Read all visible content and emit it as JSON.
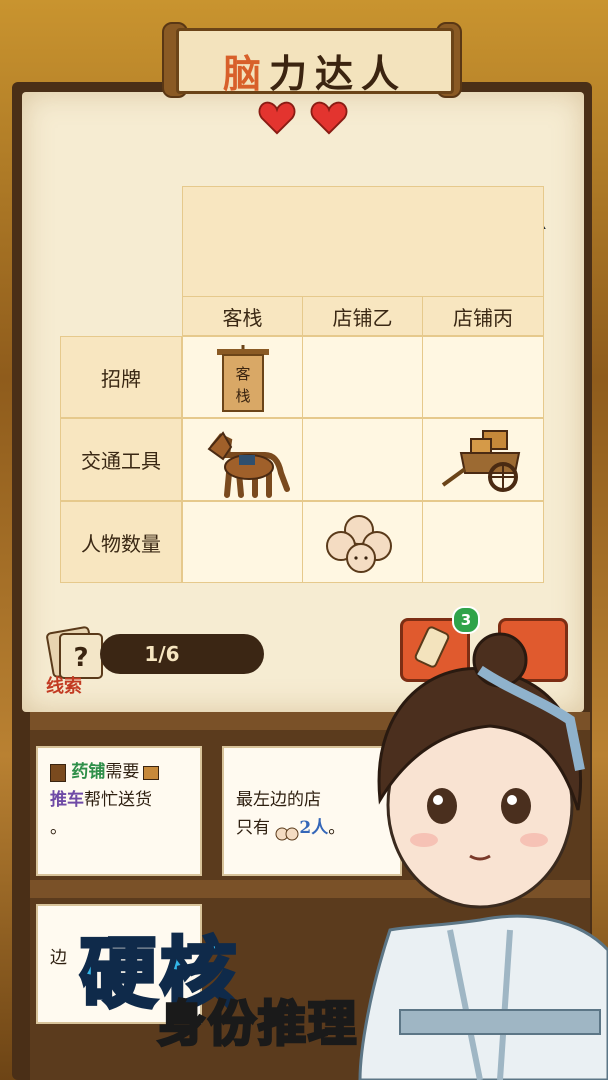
{
  "game": {
    "title_first": "脑",
    "title_rest": "力达人",
    "lives": 2,
    "colors": {
      "accent": "#d8602a",
      "heart": "#e3342f",
      "paper": "#f6ecd2",
      "badge": "#2fa34a"
    }
  },
  "puzzle": {
    "columns": [
      "客栈",
      "店铺乙",
      "店铺丙"
    ],
    "rows": [
      "招牌",
      "交通工具",
      "人物数量"
    ],
    "cells": [
      [
        "signboard-icon",
        "",
        ""
      ],
      [
        "horse-icon",
        "",
        "cart-icon"
      ],
      [
        "",
        "crowd-icon",
        ""
      ]
    ],
    "signboard_text": "客\n栈"
  },
  "clues": {
    "label": "线索",
    "progress": "1/6",
    "badge_count": "3",
    "cards": [
      {
        "part1": "药铺",
        "part2": "需要",
        "part3": "推车",
        "part4": "帮忙送货",
        "part5": "。"
      },
      {
        "line1": "最左边的店",
        "line2_prefix": "只有",
        "line2_count": "2人",
        "line2_suffix": "。"
      }
    ],
    "partial_card_text": "边"
  },
  "promo": {
    "headline": "硬核",
    "subline": "身份推理"
  }
}
